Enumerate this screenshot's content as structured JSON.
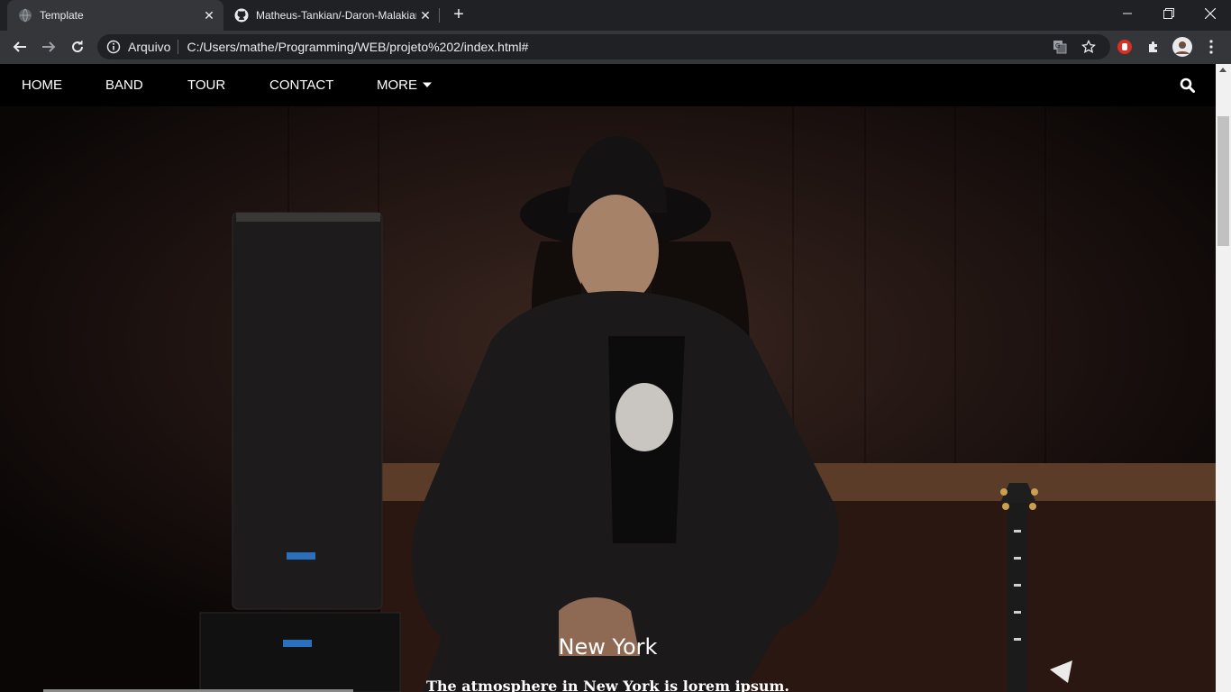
{
  "browser": {
    "tabs": [
      {
        "title": "Template",
        "active": true
      },
      {
        "title": "Matheus-Tankian/-Daron-Malakian",
        "active": false
      }
    ],
    "address": {
      "scheme_label": "Arquivo",
      "url": "C:/Users/mathe/Programming/WEB/projeto%202/index.html#"
    }
  },
  "site_nav": {
    "items": [
      "HOME",
      "BAND",
      "TOUR",
      "CONTACT"
    ],
    "more_label": "MORE"
  },
  "hero": {
    "title": "New York",
    "text": "The atmosphere in New York is lorem ipsum."
  },
  "colors": {
    "tabbar": "#202124",
    "toolbar": "#35363a",
    "site_nav": "#000000",
    "accent_ext": "#d93025"
  }
}
